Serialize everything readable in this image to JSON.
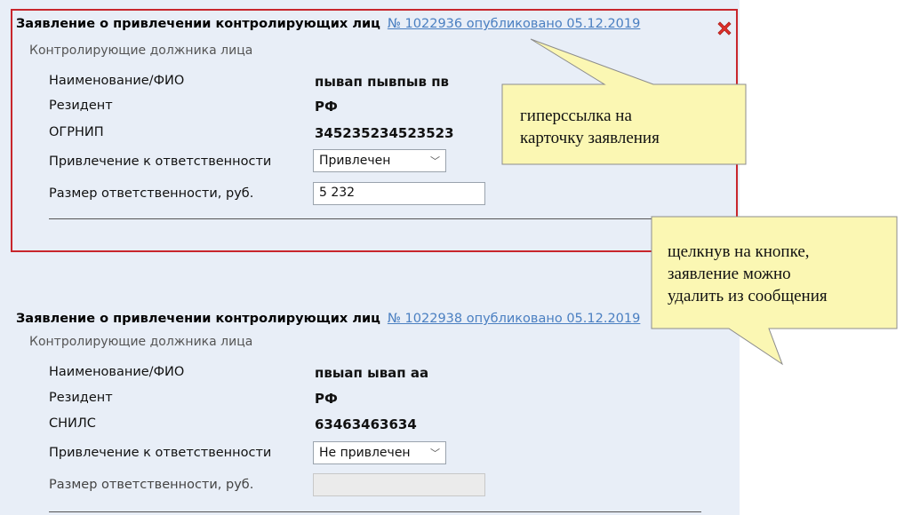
{
  "statement1": {
    "title": "Заявление о привлечении контролирующих лиц",
    "link": "№ 1022936 опубликовано 05.12.2019",
    "subtitle": "Контролирующие должника лица",
    "rows": [
      {
        "label": "Наименование/ФИО",
        "value": "пывап пывпыв пв"
      },
      {
        "label": "Резидент",
        "value": "РФ"
      },
      {
        "label": "ОГРНИП",
        "value": "345235234523523"
      }
    ],
    "liability_label": "Привлечение к ответственности",
    "liability_value": "Привлечен",
    "amount_label": "Размер ответственности, руб.",
    "amount_value": "5 232"
  },
  "statement2": {
    "title": "Заявление о привлечении контролирующих лиц",
    "link": "№ 1022938 опубликовано 05.12.2019",
    "subtitle": "Контролирующие должника лица",
    "rows": [
      {
        "label": "Наименование/ФИО",
        "value": "пвыап ывап аа"
      },
      {
        "label": "Резидент",
        "value": "РФ"
      },
      {
        "label": "СНИЛС",
        "value": "63463463634"
      }
    ],
    "liability_label": "Привлечение к ответственности",
    "liability_value": "Не привлечен",
    "amount_label": "Размер ответственности, руб.",
    "amount_value": ""
  },
  "callouts": {
    "link_note_line1": "гиперссылка на",
    "link_note_line2": "карточку заявления",
    "delete_note_line1": "щелкнув на кнопке,",
    "delete_note_line2": "заявление можно",
    "delete_note_line3": "удалить из сообщения"
  },
  "colors": {
    "card_border": "#c8262c",
    "link": "#4a7fc1",
    "callout_fill": "#fbf7b3",
    "panel_bg": "#e8eef7",
    "delete_icon": "#e0302a"
  },
  "icons": {
    "delete": "close-x-icon",
    "dropdown": "chevron-down-icon"
  }
}
